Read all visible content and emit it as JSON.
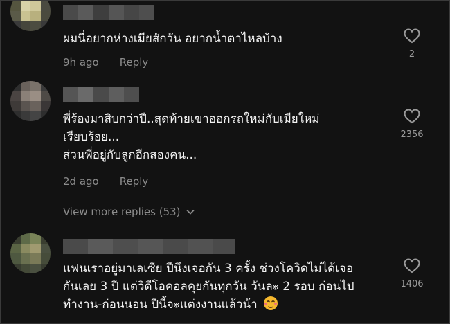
{
  "comments": [
    {
      "text": "ผมนี่อยากห่างเมียสักวัน อยากน้ำตาไหลบ้าง",
      "time": "9h ago",
      "reply_label": "Reply",
      "likes": "2"
    },
    {
      "text": "พี่ร้องมาสิบกว่าปี..สุดท้ายเขาออกรถใหม่กับเมียใหม่\nเรียบร้อย...\nส่วนพี่อยู่กับลูกอีกสองคน...",
      "time": "2d ago",
      "reply_label": "Reply",
      "likes": "2356",
      "view_more": "View more replies (53)"
    },
    {
      "text": "แฟนเราอยู่มาเลเซีย ปีนึงเจอกัน 3 ครั้ง ช่วงโควิดไม่ได้เจอ\nกันเลย 3 ปี แต่วิดีโอคอลคุยกันทุกวัน วันละ 2 รอบ ก่อนไป\nทำงาน-ก่อนนอน ปีนี้จะแต่งงานแล้วน้า",
      "likes": "1406",
      "emoji": "smiling-face-with-hearts"
    }
  ],
  "icons": {
    "like": "heart-outline-icon",
    "expand": "chevron-down-icon"
  },
  "colors": {
    "background": "#121212",
    "text": "#f2f2f2",
    "muted": "#8c8c8c"
  }
}
